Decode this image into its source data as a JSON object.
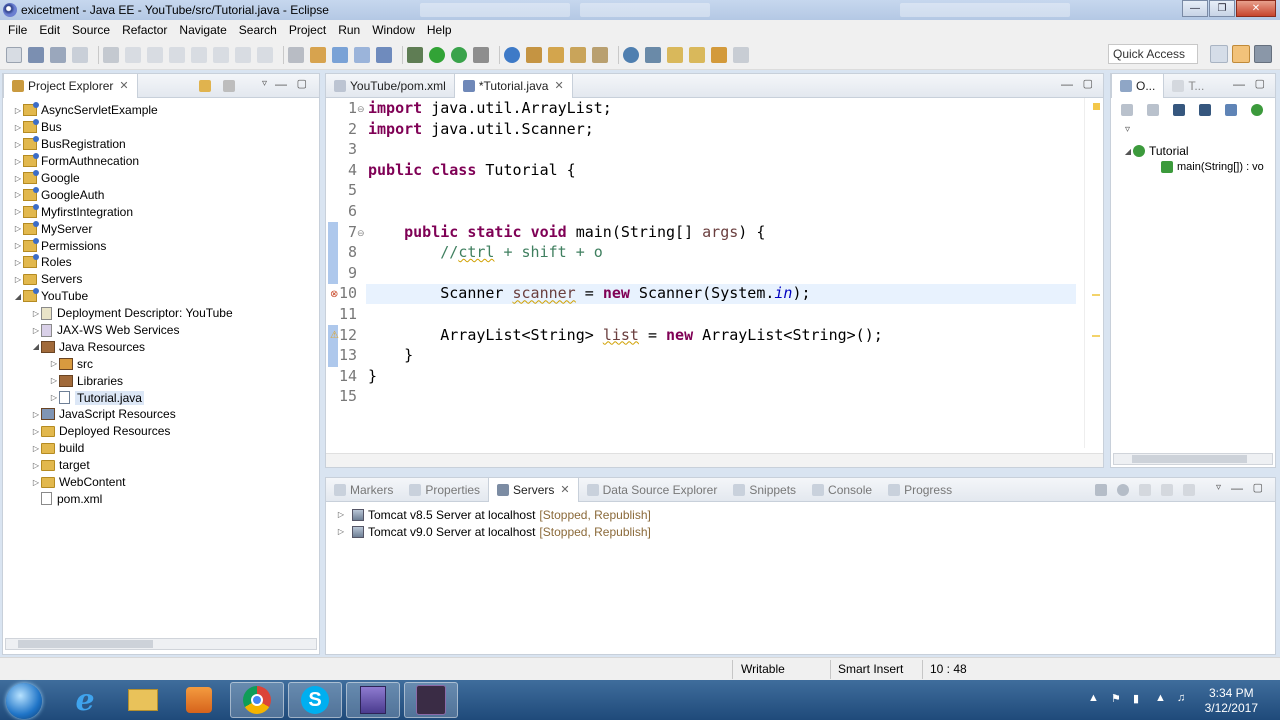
{
  "window": {
    "title": "exicetment - Java EE - YouTube/src/Tutorial.java - Eclipse"
  },
  "menu": [
    "File",
    "Edit",
    "Source",
    "Refactor",
    "Navigate",
    "Search",
    "Project",
    "Run",
    "Window",
    "Help"
  ],
  "toolbar": {
    "quick_access": "Quick Access"
  },
  "project_explorer": {
    "title": "Project Explorer",
    "items": [
      {
        "label": "AsyncServletExample",
        "indent": 0,
        "expanded": false,
        "icon": "project"
      },
      {
        "label": "Bus",
        "indent": 0,
        "expanded": false,
        "icon": "project"
      },
      {
        "label": "BusRegistration",
        "indent": 0,
        "expanded": false,
        "icon": "project"
      },
      {
        "label": "FormAuthnecation",
        "indent": 0,
        "expanded": false,
        "icon": "project"
      },
      {
        "label": "Google",
        "indent": 0,
        "expanded": false,
        "icon": "project"
      },
      {
        "label": "GoogleAuth",
        "indent": 0,
        "expanded": false,
        "icon": "project"
      },
      {
        "label": "MyfirstIntegration",
        "indent": 0,
        "expanded": false,
        "icon": "project"
      },
      {
        "label": "MyServer",
        "indent": 0,
        "expanded": false,
        "icon": "project"
      },
      {
        "label": "Permissions",
        "indent": 0,
        "expanded": false,
        "icon": "project"
      },
      {
        "label": "Roles",
        "indent": 0,
        "expanded": false,
        "icon": "project"
      },
      {
        "label": "Servers",
        "indent": 0,
        "expanded": false,
        "icon": "folder"
      },
      {
        "label": "YouTube",
        "indent": 0,
        "expanded": true,
        "icon": "project"
      },
      {
        "label": "Deployment Descriptor: YouTube",
        "indent": 1,
        "expanded": false,
        "icon": "file"
      },
      {
        "label": "JAX-WS Web Services",
        "indent": 1,
        "expanded": false,
        "icon": "file"
      },
      {
        "label": "Java Resources",
        "indent": 1,
        "expanded": true,
        "icon": "jar"
      },
      {
        "label": "src",
        "indent": 2,
        "expanded": false,
        "icon": "jar"
      },
      {
        "label": "Libraries",
        "indent": 2,
        "expanded": false,
        "icon": "jar"
      },
      {
        "label": "Tutorial.java",
        "indent": 2,
        "expanded": false,
        "icon": "file",
        "selected": true
      },
      {
        "label": "JavaScript Resources",
        "indent": 1,
        "expanded": false,
        "icon": "jar"
      },
      {
        "label": "Deployed Resources",
        "indent": 1,
        "expanded": false,
        "icon": "folder"
      },
      {
        "label": "build",
        "indent": 1,
        "expanded": false,
        "icon": "folder"
      },
      {
        "label": "target",
        "indent": 1,
        "expanded": false,
        "icon": "folder"
      },
      {
        "label": "WebContent",
        "indent": 1,
        "expanded": false,
        "icon": "folder"
      },
      {
        "label": "pom.xml",
        "indent": 1,
        "expanded": null,
        "icon": "file"
      }
    ]
  },
  "editor": {
    "tabs": [
      {
        "label": "YouTube/pom.xml",
        "active": false
      },
      {
        "label": "*Tutorial.java",
        "active": true
      }
    ],
    "line_numbers": [
      "1",
      "2",
      "3",
      "4",
      "5",
      "6",
      "7",
      "8",
      "9",
      "10",
      "11",
      "12",
      "13",
      "14",
      "15"
    ]
  },
  "outline": {
    "tab": "O...",
    "tab2": "T...",
    "class_name": "Tutorial",
    "method": "main(String[]) : vo"
  },
  "bottom": {
    "tabs": [
      "Markers",
      "Properties",
      "Servers",
      "Data Source Explorer",
      "Snippets",
      "Console",
      "Progress"
    ],
    "active": "Servers",
    "servers": [
      {
        "name": "Tomcat v8.5 Server at localhost",
        "status": "[Stopped, Republish]"
      },
      {
        "name": "Tomcat v9.0 Server at localhost",
        "status": "[Stopped, Republish]"
      }
    ]
  },
  "status": {
    "writable": "Writable",
    "insert_mode": "Smart Insert",
    "position": "10 : 48"
  },
  "taskbar": {
    "time": "3:34 PM",
    "date": "3/12/2017"
  }
}
